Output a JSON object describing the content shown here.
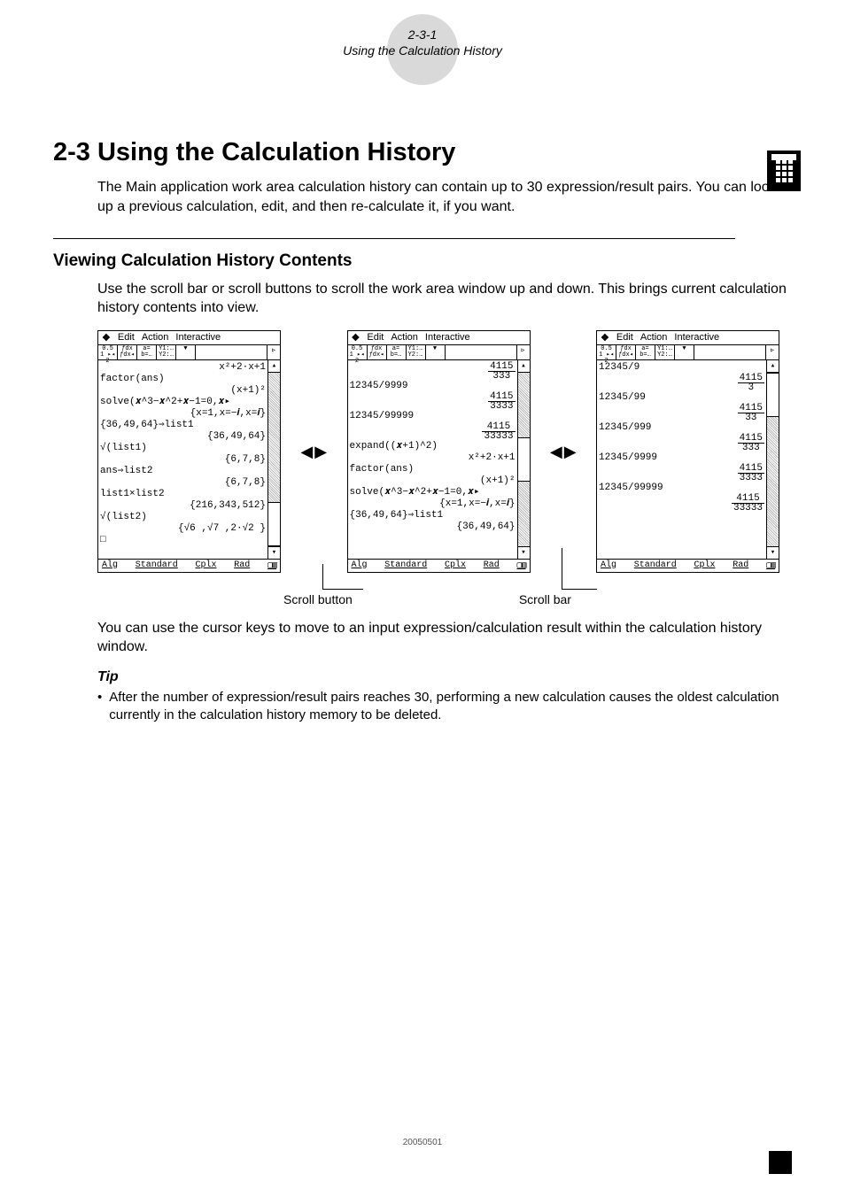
{
  "header": {
    "page_num": "2-3-1",
    "page_title": "Using the Calculation History"
  },
  "section": {
    "number": "2-3",
    "title": "Using the Calculation History",
    "intro": "The Main application work area calculation history can contain up to 30 expression/result pairs. You can look up a previous calculation, edit, and then re-calculate it, if you want."
  },
  "subsection": {
    "title": "Viewing Calculation History Contents",
    "body1": "Use the scroll bar or scroll buttons to scroll the work area window up and down. This brings current calculation history contents into view.",
    "body2": "You can use the cursor keys to move to an input expression/calculation result within the calculation history window."
  },
  "labels": {
    "scroll_button": "Scroll button",
    "scroll_bar": "Scroll bar"
  },
  "tip": {
    "heading": "Tip",
    "bullet": "•",
    "text": "After the number of expression/result pairs reaches 30, performing a new calculation causes the oldest calculation currently in the calculation history memory to be deleted."
  },
  "menubar": {
    "logo": "❖",
    "edit": "Edit",
    "action": "Action",
    "interactive": "Interactive"
  },
  "toolbar": {
    "b1": "0.5 1\n▸◂ 2",
    "b2": "ƒdx\nƒdx◂",
    "b3": "a=\nb=…",
    "b4": "Y1:…\nY2:…",
    "b5": "▼",
    "chev": "▹"
  },
  "status": {
    "mode1": "Alg",
    "mode2": "Standard",
    "mode3": "Cplx",
    "mode4": "Rad",
    "batt": "▢▥"
  },
  "scrollbar": {
    "up": "▴",
    "down": "▾"
  },
  "arrows": {
    "left": "◀",
    "right": "▶"
  },
  "shot1": {
    "lines": [
      {
        "t": "",
        "r": "x²+2·x+1"
      },
      {
        "t": "factor(ans)"
      },
      {
        "t": "",
        "r": "(x+1)²"
      },
      {
        "t": "solve(𝒙^3−𝒙^2+𝒙−1=0,𝒙▸"
      },
      {
        "t": "",
        "r": "{x=1,x=−𝒊,x=𝒊}"
      },
      {
        "t": "{36,49,64}⇒list1"
      },
      {
        "t": "",
        "r": "{36,49,64}"
      },
      {
        "t": "√(list1)"
      },
      {
        "t": "",
        "r": "{6,7,8}"
      },
      {
        "t": "ans⇒list2"
      },
      {
        "t": "",
        "r": "{6,7,8}"
      },
      {
        "t": "list1×list2"
      },
      {
        "t": "",
        "r": "{216,343,512}"
      },
      {
        "t": "√(list2)"
      },
      {
        "t": "",
        "r": "{√6 ,√7 ,2·√2 }"
      },
      {
        "t": "□"
      }
    ]
  },
  "shot2": {
    "lines": [
      {
        "t": "",
        "f": {
          "n": "4115",
          "d": "333"
        }
      },
      {
        "t": "12345/9999"
      },
      {
        "t": "",
        "f": {
          "n": "4115",
          "d": "3333"
        }
      },
      {
        "t": "12345/99999"
      },
      {
        "t": "",
        "f": {
          "n": "4115",
          "d": "33333"
        }
      },
      {
        "t": "expand((𝒙+1)^2)"
      },
      {
        "t": "",
        "r": "x²+2·x+1"
      },
      {
        "t": "factor(ans)"
      },
      {
        "t": "",
        "r": "(x+1)²"
      },
      {
        "t": "solve(𝒙^3−𝒙^2+𝒙−1=0,𝒙▸"
      },
      {
        "t": "",
        "r": "{x=1,x=−𝒊,x=𝒊}"
      },
      {
        "t": "{36,49,64}⇒list1"
      },
      {
        "t": "",
        "r": "{36,49,64}"
      }
    ]
  },
  "shot3": {
    "lines": [
      {
        "t": "12345/9"
      },
      {
        "t": "",
        "f": {
          "n": "4115",
          "d": "3"
        }
      },
      {
        "t": "12345/99"
      },
      {
        "t": "",
        "f": {
          "n": "4115",
          "d": "33"
        }
      },
      {
        "t": "12345/999"
      },
      {
        "t": "",
        "f": {
          "n": "4115",
          "d": "333"
        }
      },
      {
        "t": "12345/9999"
      },
      {
        "t": "",
        "f": {
          "n": "4115",
          "d": "3333"
        }
      },
      {
        "t": "12345/99999"
      },
      {
        "t": "",
        "f": {
          "n": "4115",
          "d": "33333"
        }
      }
    ]
  },
  "footer": {
    "date": "20050501"
  }
}
